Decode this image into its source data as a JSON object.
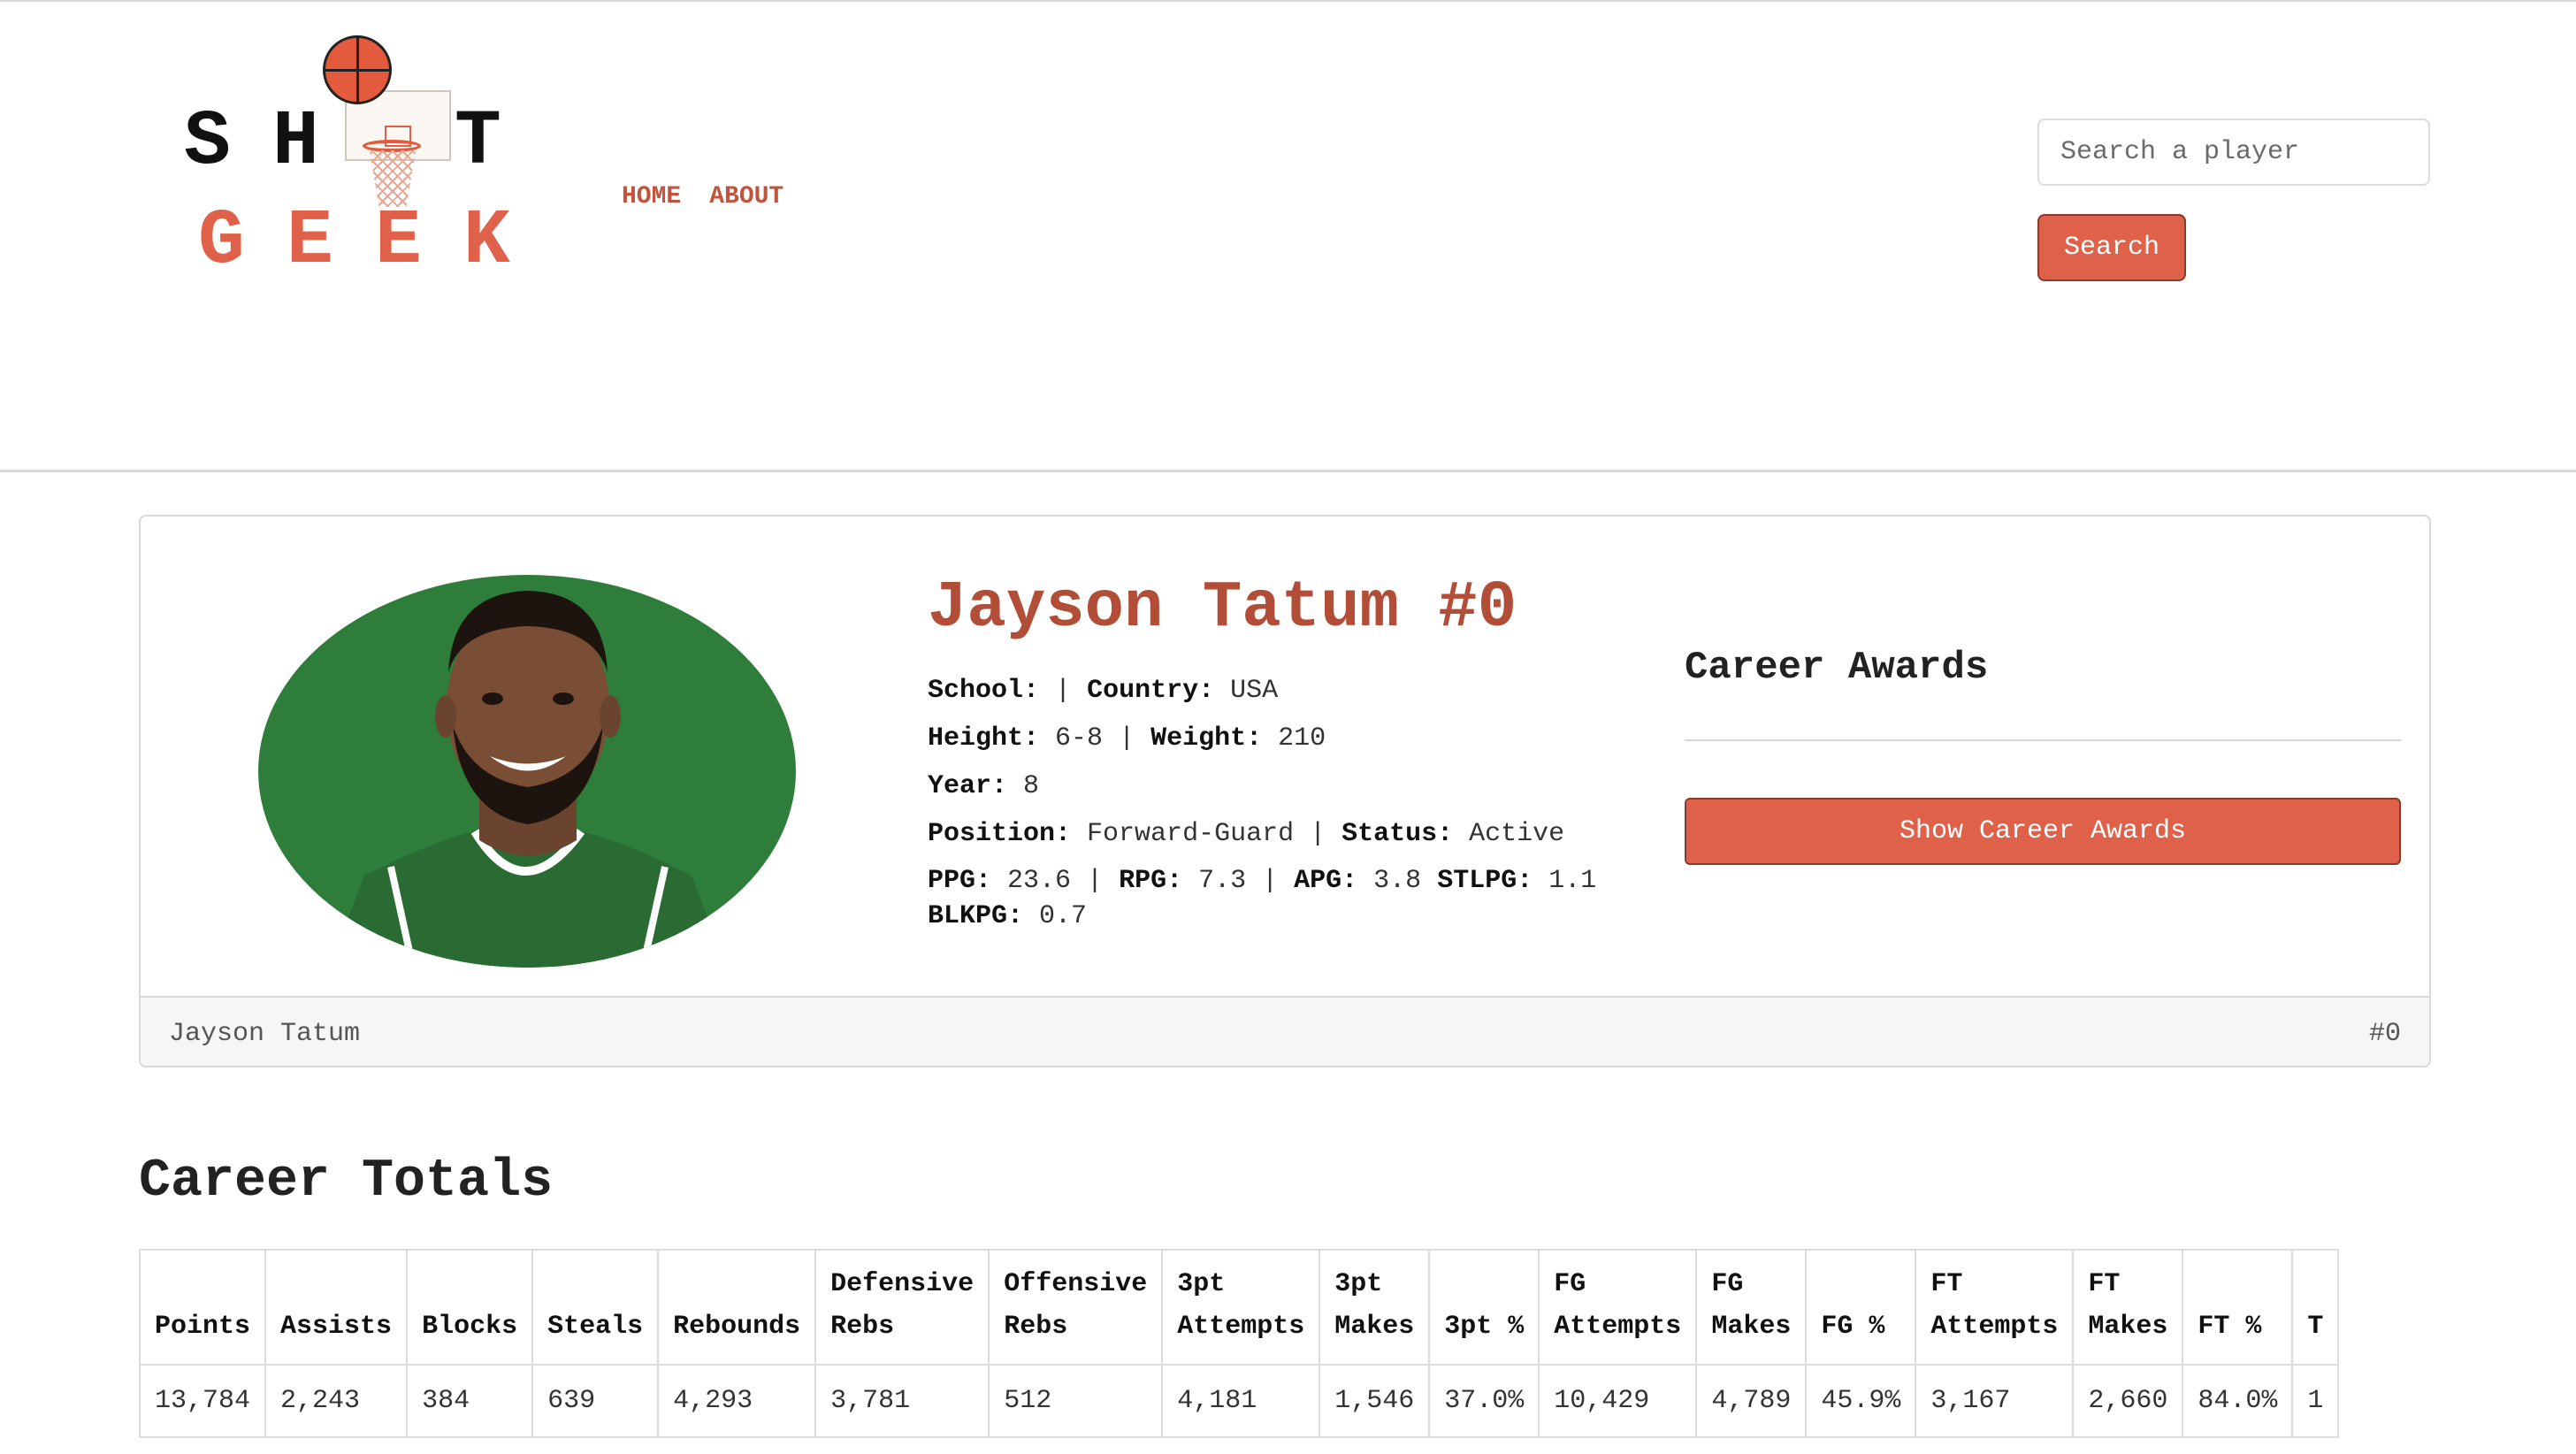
{
  "brand": {
    "logo_top": "SH  T",
    "logo_bottom": "GEEK"
  },
  "nav": {
    "home": "HOME",
    "about": "ABOUT"
  },
  "search": {
    "placeholder": "Search a player",
    "button": "Search"
  },
  "player": {
    "title": "Jayson Tatum #0",
    "school_label": "School:",
    "school_value": "",
    "country_label": "Country:",
    "country_value": "USA",
    "height_label": "Height:",
    "height_value": "6-8",
    "weight_label": "Weight:",
    "weight_value": "210",
    "year_label": "Year:",
    "year_value": "8",
    "position_label": "Position:",
    "position_value": "Forward-Guard",
    "status_label": "Status:",
    "status_value": "Active",
    "ppg_label": "PPG:",
    "ppg_value": "23.6",
    "rpg_label": "RPG:",
    "rpg_value": "7.3",
    "apg_label": "APG:",
    "apg_value": "3.8",
    "stlpg_label": "STLPG:",
    "stlpg_value": "1.1",
    "blkpg_label": "BLKPG:",
    "blkpg_value": "0.7",
    "footer_name": "Jayson Tatum",
    "footer_number": "#0"
  },
  "awards": {
    "title": "Career Awards",
    "button": "Show Career Awards"
  },
  "career_totals": {
    "title": "Career Totals",
    "headers": [
      [
        "Points"
      ],
      [
        "Assists"
      ],
      [
        "Blocks"
      ],
      [
        "Steals"
      ],
      [
        "Rebounds"
      ],
      [
        "Defensive",
        "Rebs"
      ],
      [
        "Offensive",
        "Rebs"
      ],
      [
        "3pt",
        "Attempts"
      ],
      [
        "3pt",
        "Makes"
      ],
      [
        "3pt %"
      ],
      [
        "FG",
        "Attempts"
      ],
      [
        "FG",
        "Makes"
      ],
      [
        "FG %"
      ],
      [
        "FT",
        "Attempts"
      ],
      [
        "FT",
        "Makes"
      ],
      [
        "FT %"
      ],
      [
        "T"
      ]
    ],
    "values": [
      "13,784",
      "2,243",
      "384",
      "639",
      "4,293",
      "3,781",
      "512",
      "4,181",
      "1,546",
      "37.0%",
      "10,429",
      "4,789",
      "45.9%",
      "3,167",
      "2,660",
      "84.0%",
      "1"
    ]
  },
  "colors": {
    "accent": "#e0614a",
    "name_color": "#b24d37",
    "photo_bg": "#2f7d3a"
  }
}
